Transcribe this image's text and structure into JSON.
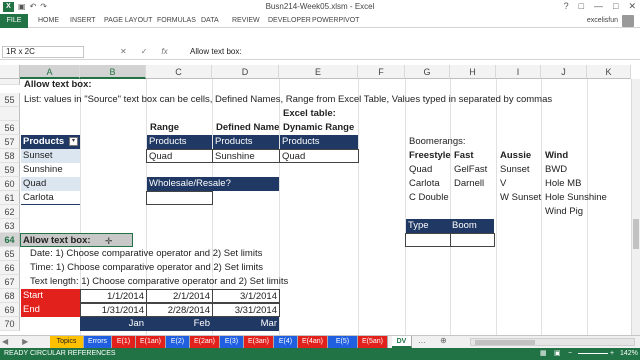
{
  "window": {
    "title": "Busn214-Week05.xlsm - Excel",
    "user": "excelisfun"
  },
  "ribbon": {
    "file": "FILE",
    "tabs": [
      "HOME",
      "INSERT",
      "PAGE LAYOUT",
      "FORMULAS",
      "DATA",
      "REVIEW",
      "DEVELOPER",
      "POWERPIVOT"
    ]
  },
  "formula_bar": {
    "name_box": "1R x 2C",
    "content": "Allow text box:"
  },
  "columns": [
    "A",
    "B",
    "C",
    "D",
    "E",
    "F",
    "G",
    "H",
    "I",
    "J",
    "K"
  ],
  "rows": [
    "54",
    "55",
    "56",
    "57",
    "58",
    "59",
    "60",
    "61",
    "62",
    "63",
    "64",
    "65",
    "66",
    "67",
    "68",
    "69",
    "70"
  ],
  "cells": {
    "a54": "Allow text box:",
    "a55": "List: values in \"Source\" text box can be cells, Defined Names, Range from Excel Table, Values typed in separated by commas",
    "e56": "Excel table:",
    "c57": "Range",
    "d57": "Defined Name",
    "e57": "Dynamic Range",
    "a57": "Products",
    "c58": "Products",
    "d58": "Products",
    "e58": "Products",
    "a58": "Sunset",
    "a59": "Sunshine",
    "a60": "Quad",
    "a61": "Carlota",
    "c59": "Quad",
    "d59": "Sunshine",
    "e59": "Quad",
    "c61": "Wholesale/Resale?",
    "g57": "Boomerangs:",
    "g58": "Freestyle",
    "h58": "Fast",
    "i58": "Aussie",
    "j58": "Wind",
    "g59": "Quad",
    "h59": "GelFast",
    "i59": "Sunset",
    "j59": "BWD",
    "g60": "Carlota",
    "h60": "Darnell",
    "i60": "V",
    "j60": "Hole MB",
    "g61": "C Double",
    "i61": "W Sunset",
    "j61": "Hole Sunshine",
    "j62": "Wind Pig",
    "g63": "Type",
    "h63": "Boom",
    "a64": "Allow text box:",
    "a65": "Date: 1) Choose comparative operator and 2) Set limits",
    "a66": "Time: 1) Choose comparative operator and 2) Set limits",
    "a67": "Text length: 1) Choose comparative operator and 2) Set limits",
    "a68": "Start",
    "b68": "1/1/2014",
    "c68": "2/1/2014",
    "d68": "3/1/2014",
    "a69": "End",
    "b69": "1/31/2014",
    "c69": "2/28/2014",
    "d69": "3/31/2014",
    "b70": "Jan",
    "c70": "Feb",
    "d70": "Mar"
  },
  "sheet_tabs": [
    "Topics",
    "Errors",
    "E(1)",
    "E(1an)",
    "E(2)",
    "E(2an)",
    "E(3)",
    "E(3an)",
    "E(4)",
    "E(4an)",
    "E(5)",
    "E(5an)",
    "DV"
  ],
  "status": {
    "ready": "READY",
    "circular": "CIRCULAR REFERENCES",
    "zoom": "142%"
  },
  "colors": {
    "excel_green": "#217346",
    "navy": "#1f3864",
    "red": "#e3211c",
    "topics_tab": "#ffc000",
    "blue_tab": "#1f5fe0"
  }
}
